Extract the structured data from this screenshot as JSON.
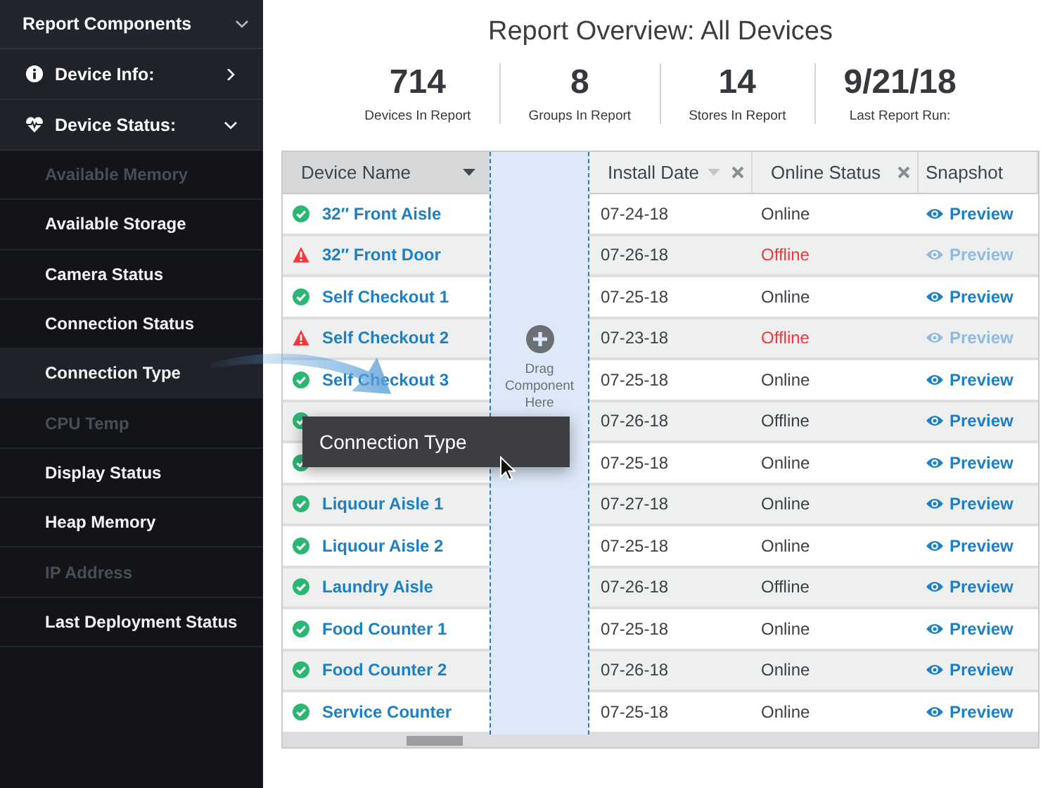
{
  "sidebar": {
    "title": "Report Components",
    "expanded": true,
    "categories": [
      {
        "label": "Device Info:",
        "expanded": false
      },
      {
        "label": "Device Status:",
        "expanded": true,
        "items": [
          {
            "label": "Available Memory",
            "disabled": true,
            "selected": false
          },
          {
            "label": "Available Storage",
            "disabled": false,
            "selected": false
          },
          {
            "label": "Camera Status",
            "disabled": false,
            "selected": false
          },
          {
            "label": "Connection Status",
            "disabled": false,
            "selected": false
          },
          {
            "label": "Connection Type",
            "disabled": false,
            "selected": true
          },
          {
            "label": "CPU Temp",
            "disabled": true,
            "selected": false
          },
          {
            "label": "Display Status",
            "disabled": false,
            "selected": false
          },
          {
            "label": "Heap Memory",
            "disabled": false,
            "selected": false
          },
          {
            "label": "IP Address",
            "disabled": true,
            "selected": false
          },
          {
            "label": "Last Deployment Status",
            "disabled": false,
            "selected": false
          }
        ]
      }
    ]
  },
  "title": "Report Overview: All Devices",
  "stats": [
    {
      "value": "714",
      "label": "Devices In Report"
    },
    {
      "value": "8",
      "label": "Groups In Report"
    },
    {
      "value": "14",
      "label": "Stores In Report"
    },
    {
      "value": "9/21/18",
      "label": "Last Report Run:"
    }
  ],
  "table": {
    "columns": [
      {
        "label": "Device Name",
        "sortable": true,
        "sorted": true,
        "removable": false
      },
      {
        "label": "Install Date",
        "sortable": true,
        "sorted": false,
        "removable": true
      },
      {
        "label": "Online Status",
        "sortable": false,
        "sorted": false,
        "removable": true
      },
      {
        "label": "Snapshot",
        "sortable": false,
        "sorted": false,
        "removable": false
      }
    ],
    "drop_zone": {
      "label": "Drag Component Here"
    },
    "rows": [
      {
        "kind": "ok",
        "name": "32″ Front Aisle",
        "install_date": "07-24-18",
        "online_status": "Online",
        "preview": "Preview"
      },
      {
        "kind": "warning",
        "name": "32″ Front Door",
        "install_date": "07-26-18",
        "online_status": "Offline",
        "preview": "Preview"
      },
      {
        "kind": "ok",
        "name": "Self Checkout 1",
        "install_date": "07-25-18",
        "online_status": "Online",
        "preview": "Preview"
      },
      {
        "kind": "warning",
        "name": "Self Checkout 2",
        "install_date": "07-23-18",
        "online_status": "Offline",
        "preview": "Preview"
      },
      {
        "kind": "ok",
        "name": "Self Checkout 3",
        "install_date": "07-25-18",
        "online_status": "Online",
        "preview": "Preview"
      },
      {
        "kind": "ok",
        "install_date": "07-26-18",
        "online_status": "Offline",
        "preview": "Preview"
      },
      {
        "kind": "ok",
        "install_date": "07-25-18",
        "online_status": "Online",
        "preview": "Preview"
      },
      {
        "kind": "ok",
        "name": "Liquour Aisle 1",
        "install_date": "07-27-18",
        "online_status": "Online",
        "preview": "Preview"
      },
      {
        "kind": "ok",
        "name": "Liquour Aisle 2",
        "install_date": "07-25-18",
        "online_status": "Online",
        "preview": "Preview"
      },
      {
        "kind": "ok",
        "name": "Laundry Aisle",
        "install_date": "07-26-18",
        "online_status": "Offline",
        "preview": "Preview"
      },
      {
        "kind": "ok",
        "name": "Food Counter 1",
        "install_date": "07-25-18",
        "online_status": "Online",
        "preview": "Preview"
      },
      {
        "kind": "ok",
        "name": "Food Counter 2",
        "install_date": "07-26-18",
        "online_status": "Online",
        "preview": "Preview"
      },
      {
        "kind": "ok",
        "name": "Service Counter",
        "install_date": "07-25-18",
        "online_status": "Online",
        "preview": "Preview"
      }
    ]
  },
  "drag_tooltip": {
    "label": "Connection Type"
  }
}
